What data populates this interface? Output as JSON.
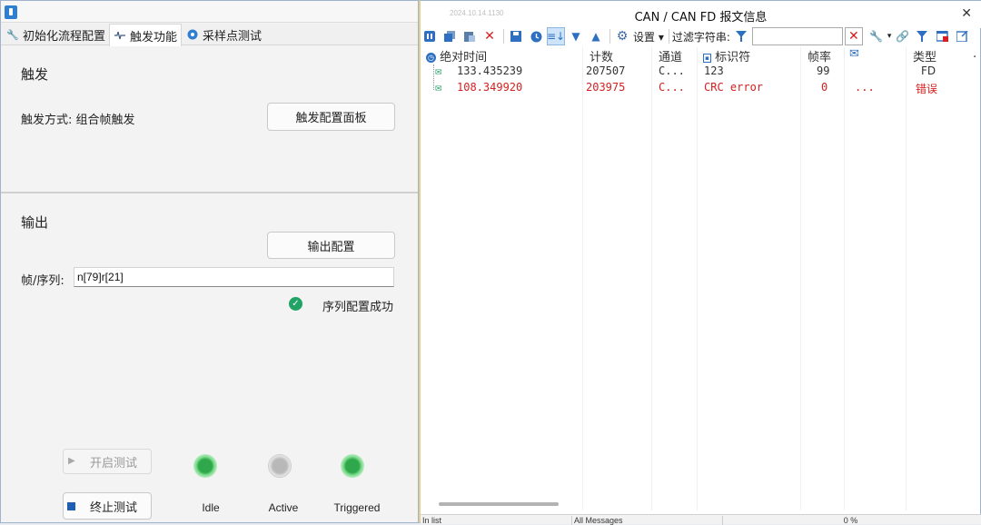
{
  "left": {
    "tabs": [
      {
        "label": "初始化流程配置",
        "icon": "wrench-icon"
      },
      {
        "label": "触发功能",
        "icon": "waveform-icon"
      },
      {
        "label": "采样点测试",
        "icon": "sample-icon"
      }
    ],
    "trigger": {
      "title": "触发",
      "mode_label": "触发方式: 组合帧触发",
      "panel_button": "触发配置面板"
    },
    "output": {
      "title": "输出",
      "config_button": "输出配置",
      "seq_label": "帧/序列:",
      "seq_value": "n[79]r[21]",
      "status_text": "序列配置成功"
    },
    "controls": {
      "start_button": "开启测试",
      "stop_button": "终止测试",
      "leds": [
        {
          "label": "Idle",
          "state": "on"
        },
        {
          "label": "Active",
          "state": "off"
        },
        {
          "label": "Triggered",
          "state": "on"
        }
      ]
    }
  },
  "right": {
    "timestamp": "2024.10.14.1130",
    "title": "CAN / CAN FD 报文信息",
    "toolbar": {
      "settings_label": "设置",
      "filter_label": "过滤字符串:"
    },
    "columns": [
      "绝对时间",
      "计数",
      "通道",
      "标识符",
      "帧率",
      "类型"
    ],
    "rows": [
      {
        "time": "133.435239",
        "count": "207507",
        "channel": "C...",
        "id": "123",
        "rate": "99",
        "data": "",
        "type": "FD",
        "error": false
      },
      {
        "time": "108.349920",
        "count": "203975",
        "channel": "C...",
        "id": "CRC error",
        "rate": "0",
        "data": "...",
        "type": "错误",
        "error": true
      }
    ],
    "status": {
      "left": "In list",
      "middle": "All Messages",
      "right": "0 %"
    }
  },
  "colors": {
    "error_red": "#d42020",
    "normal_text": "#333333",
    "led_green": "#2ea84a",
    "accent_blue": "#2e6fc2"
  }
}
